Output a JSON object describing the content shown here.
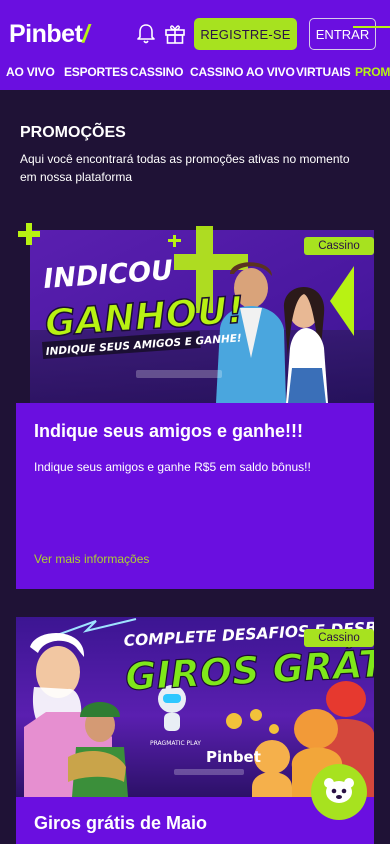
{
  "header": {
    "logo_main": "Pinbet",
    "logo_mark": "/",
    "register_label": "REGISTRE-SE",
    "login_label": "ENTRAR"
  },
  "nav": {
    "items": [
      {
        "label": "AO VIVO"
      },
      {
        "label": "ESPORTES"
      },
      {
        "label": "CASSINO"
      },
      {
        "label": "CASSINO AO VIVO"
      },
      {
        "label": "VIRTUAIS"
      },
      {
        "label": "PROMO"
      }
    ],
    "active_index": 5
  },
  "page": {
    "title": "PROMOÇÕES",
    "description": "Aqui você encontrará todas as promoções ativas no momento em nossa plataforma"
  },
  "promos": [
    {
      "badge": "Cassino",
      "banner_line1": "INDICOU",
      "banner_line2": "GANHOU!",
      "banner_line3": "INDIQUE SEUS AMIGOS E GANHE!",
      "title": "Indique seus amigos e ganhe!!!",
      "text": "Indique seus amigos e ganhe R$5 em saldo bônus!!",
      "link": "Ver mais informações"
    },
    {
      "badge": "Cassino",
      "banner_line1": "COMPLETE DESAFIOS E DESBLOQUEIE",
      "banner_line2": "GIROS GRÁTIS",
      "banner_brand": "Pinbet",
      "banner_partner": "PRAGMATIC PLAY",
      "title": "Giros grátis de Maio"
    }
  ],
  "colors": {
    "background": "#1f1236",
    "primary": "#6a0fe0",
    "accent": "#a7e21f"
  }
}
